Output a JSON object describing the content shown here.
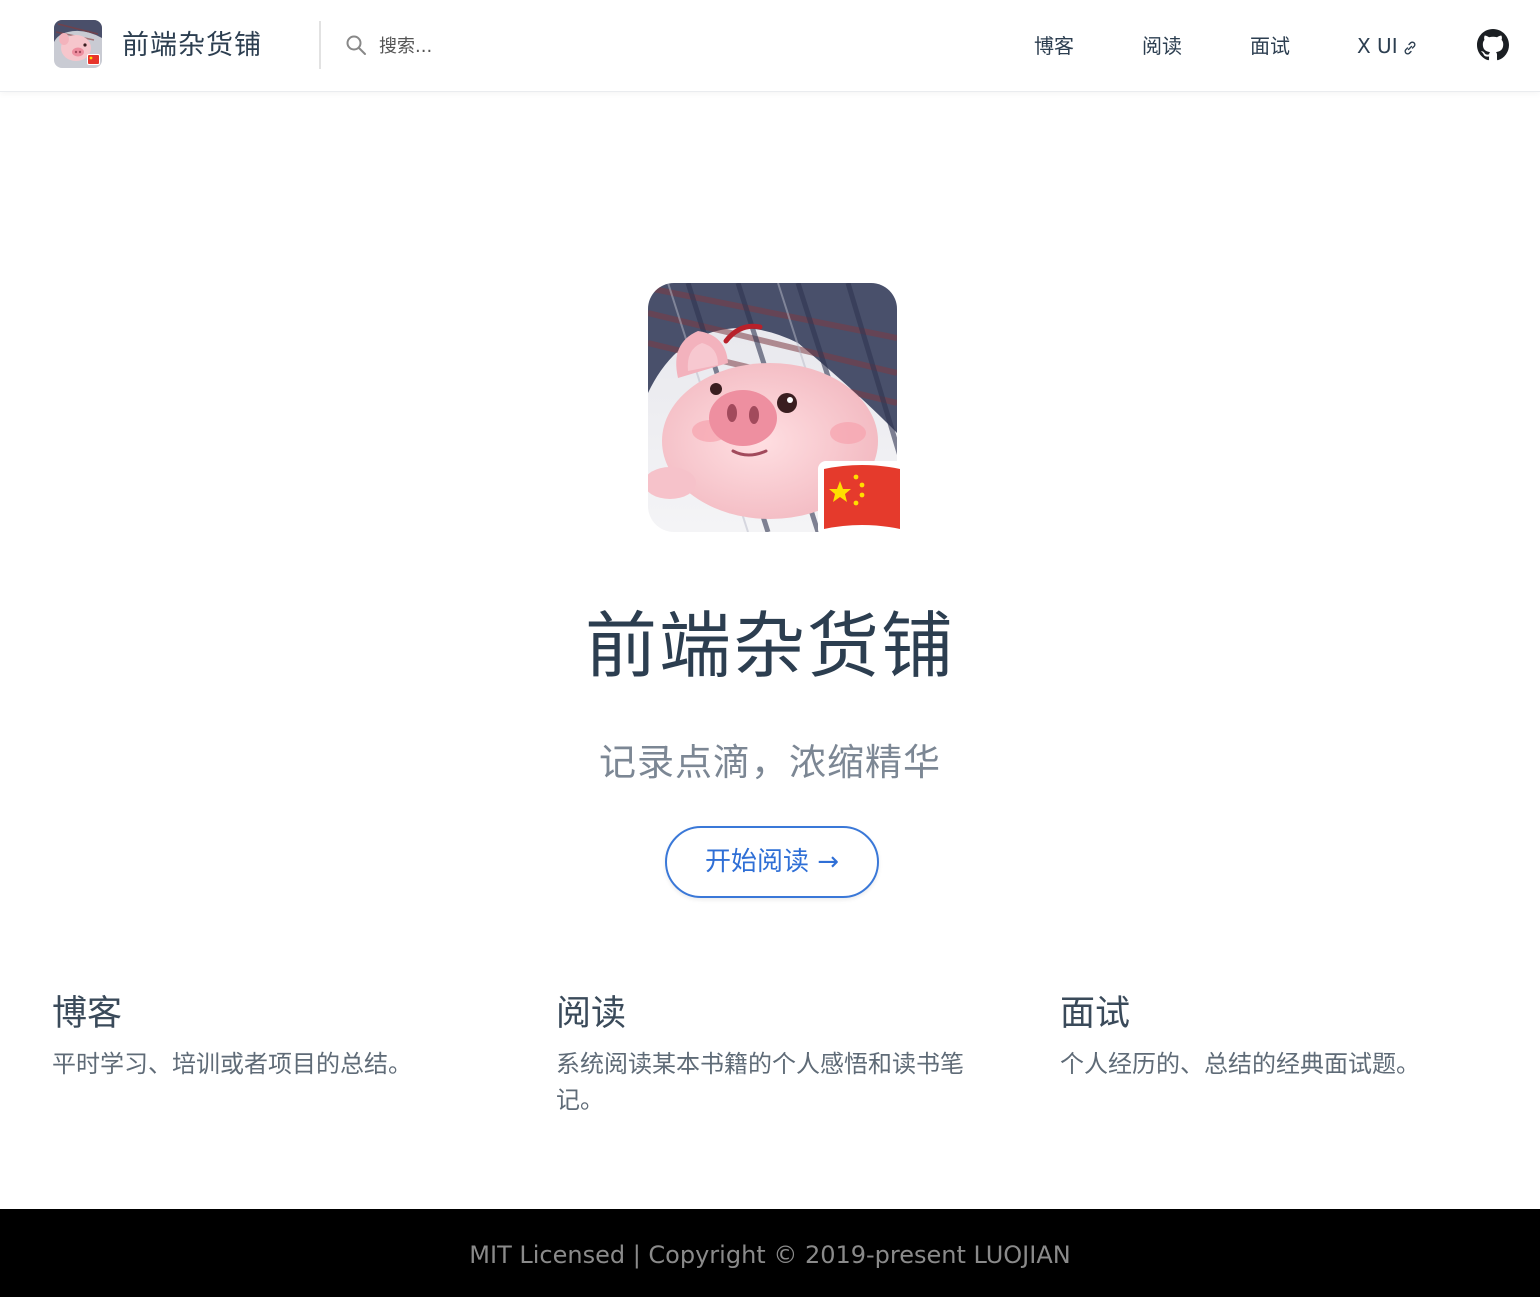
{
  "navbar": {
    "logo_alt": "pig-avatar-logo",
    "site_title": "前端杂货铺",
    "search": {
      "placeholder": "搜索...",
      "value": ""
    },
    "links": [
      {
        "label": "博客"
      },
      {
        "label": "阅读"
      },
      {
        "label": "面试"
      },
      {
        "label": "X UI",
        "external": true
      }
    ],
    "github_icon": "github-icon"
  },
  "hero": {
    "image": "pig-with-china-flag",
    "title": "前端杂货铺",
    "tagline": "记录点滴，浓缩精华",
    "cta_label": "开始阅读 →"
  },
  "features": [
    {
      "title": "博客",
      "details": "平时学习、培训或者项目的总结。"
    },
    {
      "title": "阅读",
      "details": "系统阅读某本书籍的个人感悟和读书笔记。"
    },
    {
      "title": "面试",
      "details": "个人经历的、总结的经典面试题。"
    }
  ],
  "footer": {
    "text": "MIT Licensed | Copyright © 2019-present LUOJIAN"
  },
  "colors": {
    "accent": "#3a78d8",
    "text": "#2c3e50",
    "footer_bg": "#000000"
  }
}
